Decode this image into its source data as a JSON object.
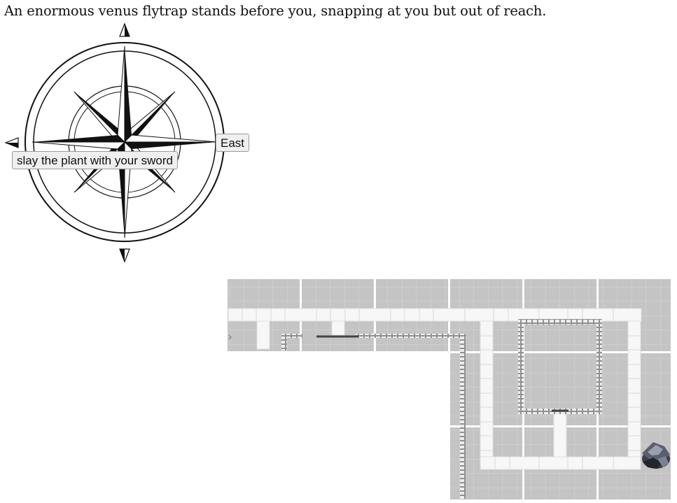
{
  "scene": {
    "message": "An enormous venus flytrap stands before you, snapping at you but out of reach."
  },
  "compass": {
    "north_arrow_icon": "triangle-up-icon",
    "south_arrow_icon": "triangle-down-icon",
    "west_arrow_icon": "triangle-left-icon",
    "east_label": "East"
  },
  "actions": {
    "primary_label": "slay the plant with your sword"
  },
  "minimap": {
    "tile_color": "#c4c4c4",
    "path_color": "#f7f7f7",
    "wall_color": "#8a8a8a",
    "player_icon": "rock-creature-icon"
  }
}
